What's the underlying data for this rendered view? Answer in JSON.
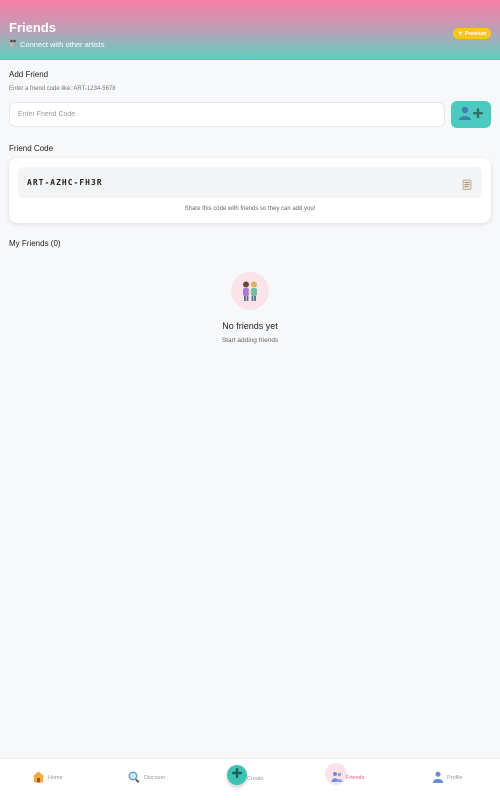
{
  "header": {
    "title": "Friends",
    "subtitle": "Connect with other artists",
    "premium_label": "Premium"
  },
  "add_friend": {
    "title": "Add Friend",
    "hint": "Enter a friend code like: ART-1234-5678",
    "input_placeholder": "Enter Friend Code",
    "input_value": ""
  },
  "friend_code": {
    "title": "Friend Code",
    "code": "ART-AZHC-FH3R",
    "note": "Share this code with friends so they can add you!"
  },
  "my_friends": {
    "title": "My Friends (0)",
    "empty_title": "No friends yet",
    "empty_subtitle": "Start adding friends"
  },
  "nav": {
    "home": "Home",
    "discover": "Discover",
    "create": "Create",
    "friends": "Friends",
    "profile": "Profile",
    "active": "friends"
  },
  "colors": {
    "accent_teal": "#4ccac0",
    "accent_pink": "#e35c97",
    "premium_yellow": "#ffc61a",
    "header_gradient_top": "#f77fa6",
    "header_gradient_bottom": "#5fcfc0"
  },
  "icons": {
    "subtitle": "people-icon",
    "premium": "star-icon",
    "add_friend": "add-person-icon",
    "copy": "copy-icon",
    "empty_state": "people-holding-hands-icon",
    "home": "house-icon",
    "discover": "magnifier-icon",
    "create": "plus-icon",
    "friends": "people-icon",
    "profile": "person-icon"
  }
}
